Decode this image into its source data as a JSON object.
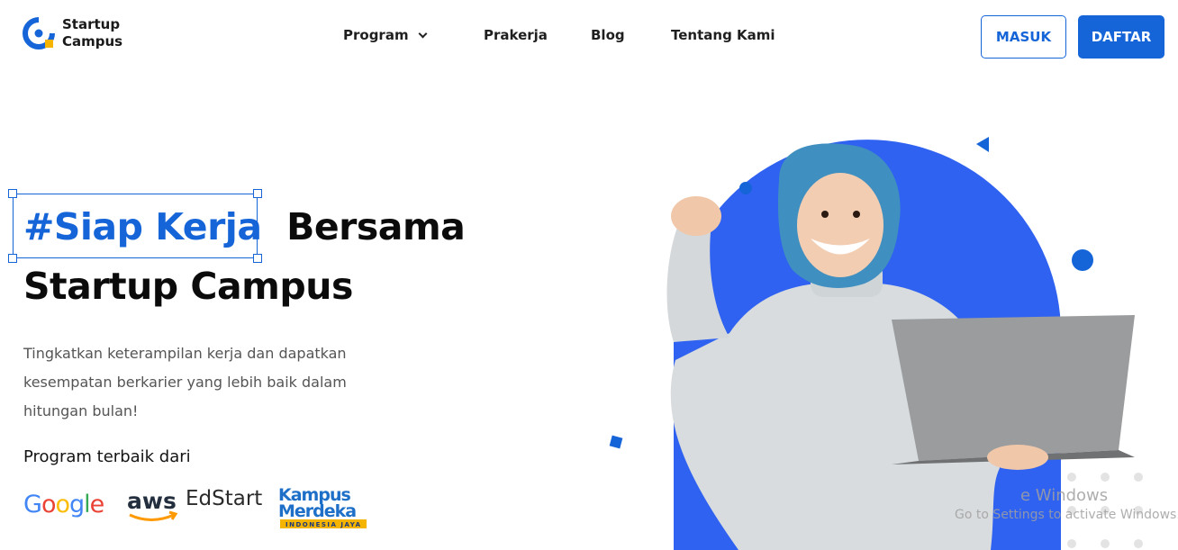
{
  "brand": {
    "name_line1": "Startup",
    "name_line2": "Campus",
    "logo_icon": "startup-campus-logo",
    "color_primary": "#1565d8",
    "color_accent": "#f5b400"
  },
  "nav": {
    "items": [
      {
        "label": "Program",
        "has_dropdown": true
      },
      {
        "label": "Prakerja"
      },
      {
        "label": "Blog"
      },
      {
        "label": "Tentang Kami"
      }
    ]
  },
  "auth": {
    "login_label": "MASUK",
    "register_label": "DAFTAR"
  },
  "hero": {
    "headline_highlight": "#Siap Kerja",
    "headline_rest": "Bersama",
    "headline_line2": "Startup Campus",
    "description": "Tingkatkan keterampilan kerja dan dapatkan kesempatan berkarier yang lebih baik dalam hitungan bulan!",
    "program_label": "Program terbaik dari",
    "partners": [
      {
        "name": "Google",
        "icon": "google-logo"
      },
      {
        "name": "aws",
        "icon": "aws-logo"
      },
      {
        "name": "EdStart",
        "icon": "edstart-logo"
      },
      {
        "name": "Kampus Merdeka",
        "tagline": "INDONESIA JAYA",
        "icon": "kampus-merdeka-logo"
      }
    ]
  },
  "watermark": {
    "line1": "e Windows",
    "line2": "Go to Settings to activate Windows."
  }
}
